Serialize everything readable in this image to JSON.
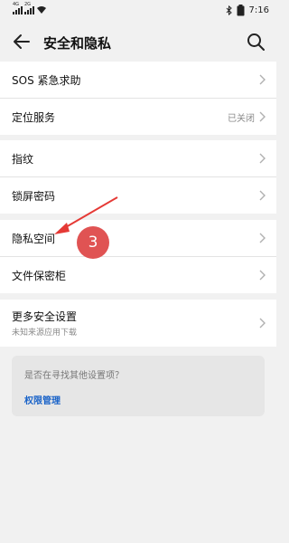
{
  "status_bar": {
    "time": "7:16",
    "sig1_tag": "4G",
    "sig2_tag": "2G",
    "icons": [
      "bluetooth-icon",
      "battery-icon"
    ]
  },
  "header": {
    "title": "安全和隐私",
    "back_icon": "arrow-left-icon",
    "search_icon": "search-icon"
  },
  "groups": [
    {
      "items": [
        {
          "label": "SOS 紧急求助",
          "value": ""
        },
        {
          "label": "定位服务",
          "value": "已关闭"
        }
      ]
    },
    {
      "items": [
        {
          "label": "指纹"
        },
        {
          "label": "锁屏密码"
        }
      ]
    },
    {
      "items": [
        {
          "label": "隐私空间"
        },
        {
          "label": "文件保密柜"
        }
      ]
    },
    {
      "items": [
        {
          "label": "更多安全设置",
          "sub": "未知来源应用下载"
        }
      ]
    }
  ],
  "suggest": {
    "question": "是否在寻找其他设置项？",
    "link": "权限管理"
  },
  "annotation": {
    "badge": "3",
    "color": "#e05353"
  }
}
